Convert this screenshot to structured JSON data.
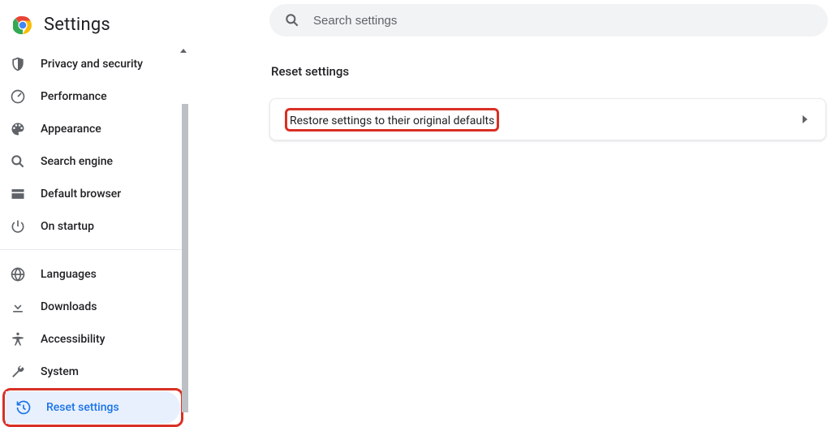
{
  "page_title": "Settings",
  "search": {
    "placeholder": "Search settings"
  },
  "sidebar": {
    "group1": [
      {
        "id": "privacy",
        "label": "Privacy and security",
        "icon": "shield-icon"
      },
      {
        "id": "performance",
        "label": "Performance",
        "icon": "speedometer-icon"
      },
      {
        "id": "appearance",
        "label": "Appearance",
        "icon": "palette-icon"
      },
      {
        "id": "search-engine",
        "label": "Search engine",
        "icon": "search-icon"
      },
      {
        "id": "default-browser",
        "label": "Default browser",
        "icon": "browser-icon"
      },
      {
        "id": "on-startup",
        "label": "On startup",
        "icon": "power-icon"
      }
    ],
    "group2": [
      {
        "id": "languages",
        "label": "Languages",
        "icon": "globe-icon"
      },
      {
        "id": "downloads",
        "label": "Downloads",
        "icon": "download-icon"
      },
      {
        "id": "accessibility",
        "label": "Accessibility",
        "icon": "accessibility-icon"
      },
      {
        "id": "system",
        "label": "System",
        "icon": "wrench-icon"
      },
      {
        "id": "reset",
        "label": "Reset settings",
        "icon": "history-icon",
        "active": true,
        "highlighted": true
      }
    ]
  },
  "main": {
    "section_title": "Reset settings",
    "card_row_label": "Restore settings to their original defaults"
  }
}
